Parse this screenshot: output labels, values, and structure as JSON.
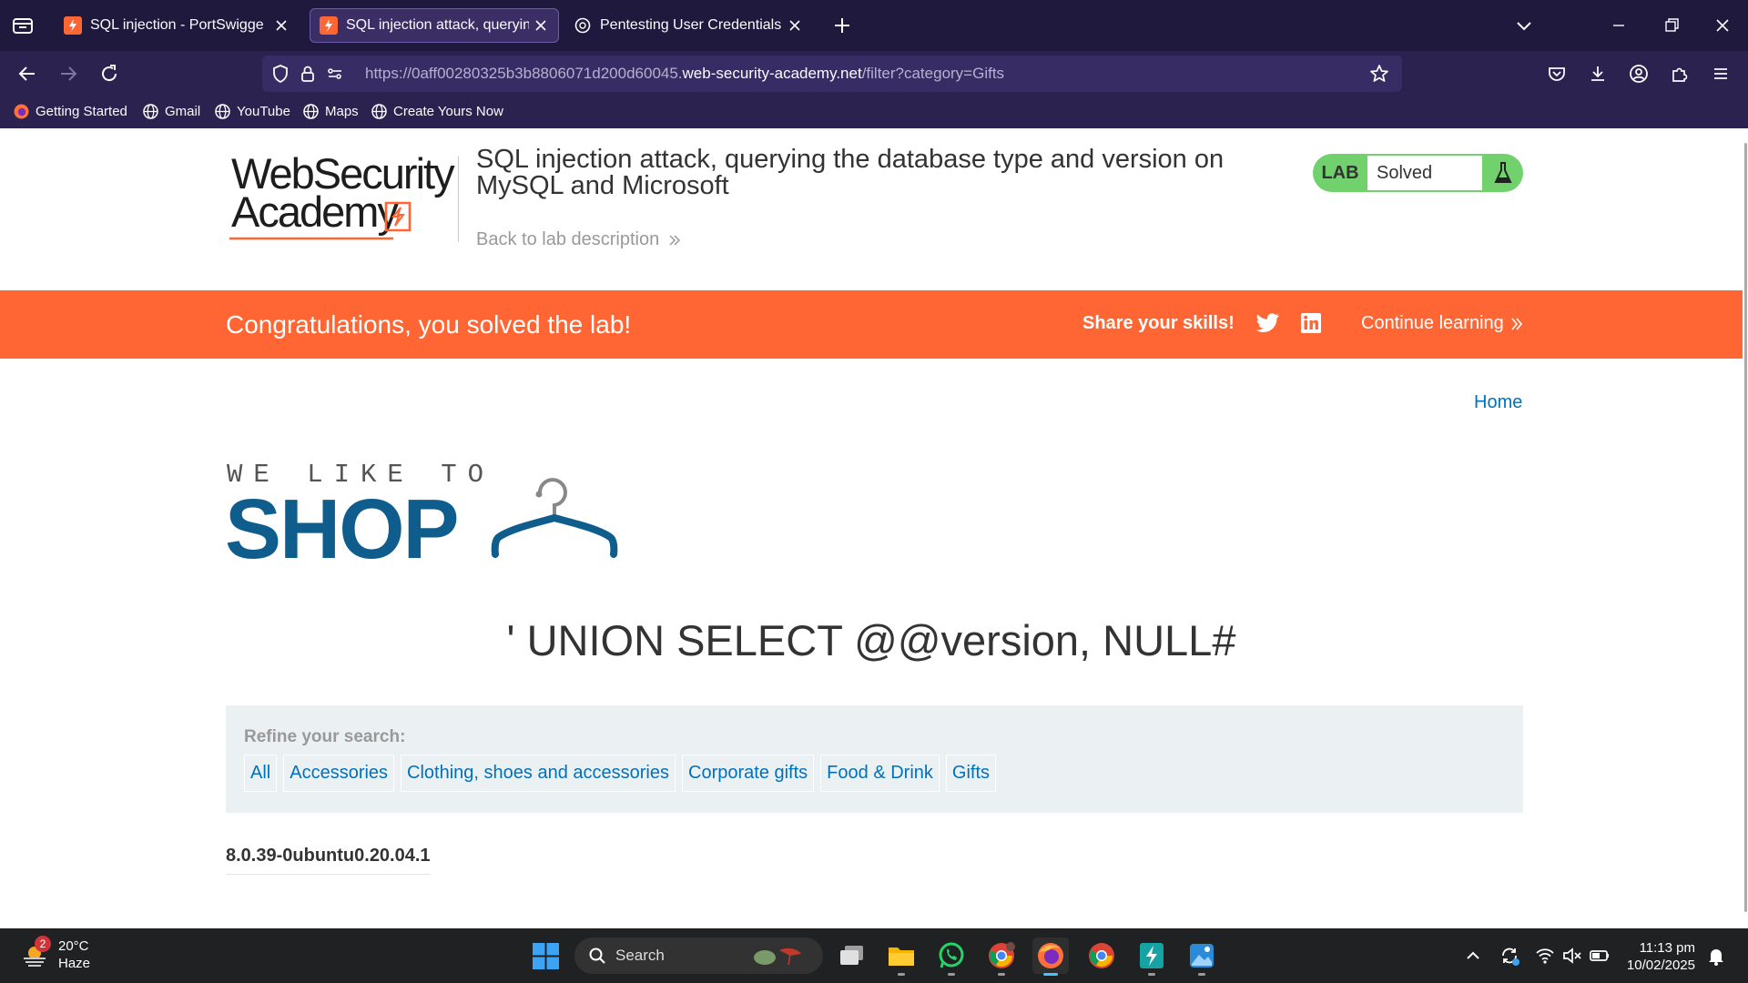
{
  "browser": {
    "tabs": [
      {
        "title": "SQL injection - PortSwigger",
        "icon": "portswigger-icon",
        "active": false
      },
      {
        "title": "SQL injection attack, querying the",
        "icon": "portswigger-icon",
        "active": true
      },
      {
        "title": "Pentesting User Credentials Ret",
        "icon": "chatgpt-icon",
        "active": false
      }
    ],
    "url_prefix": "https://0aff00280325b3b8806071d200d60045.",
    "url_domain": "web-security-academy.net",
    "url_path": "/filter?category=Gifts",
    "bookmarks": [
      "Getting Started",
      "Gmail",
      "YouTube",
      "Maps",
      "Create Yours Now"
    ]
  },
  "header": {
    "logo_line1": "WebSecurity",
    "logo_line2": "Academy",
    "lab_title": "SQL injection attack, querying the database type and version on MySQL and Microsoft",
    "back_link": "Back to lab description",
    "badge_label": "LAB",
    "badge_status": "Solved"
  },
  "banner": {
    "message": "Congratulations, you solved the lab!",
    "share": "Share your skills!",
    "continue": "Continue learning"
  },
  "shop": {
    "home": "Home",
    "logo_small": "WE LIKE TO",
    "logo_big": "SHOP",
    "search_heading": "' UNION SELECT @@version, NULL#",
    "refine_label": "Refine your search:",
    "categories": [
      "All",
      "Accessories",
      "Clothing, shoes and accessories",
      "Corporate gifts",
      "Food & Drink",
      "Gifts"
    ],
    "result": "8.0.39-0ubuntu0.20.04.1"
  },
  "taskbar": {
    "weather_temp": "20°C",
    "weather_desc": "Haze",
    "weather_badge": "2",
    "search_label": "Search",
    "time": "11:13 pm",
    "date": "10/02/2025"
  },
  "colors": {
    "brand_orange": "#ff6633",
    "link_blue": "#0071bc",
    "shop_blue": "#0e5d8c",
    "lab_green": "#70d16d",
    "browser_bg": "#1f1a3d"
  }
}
